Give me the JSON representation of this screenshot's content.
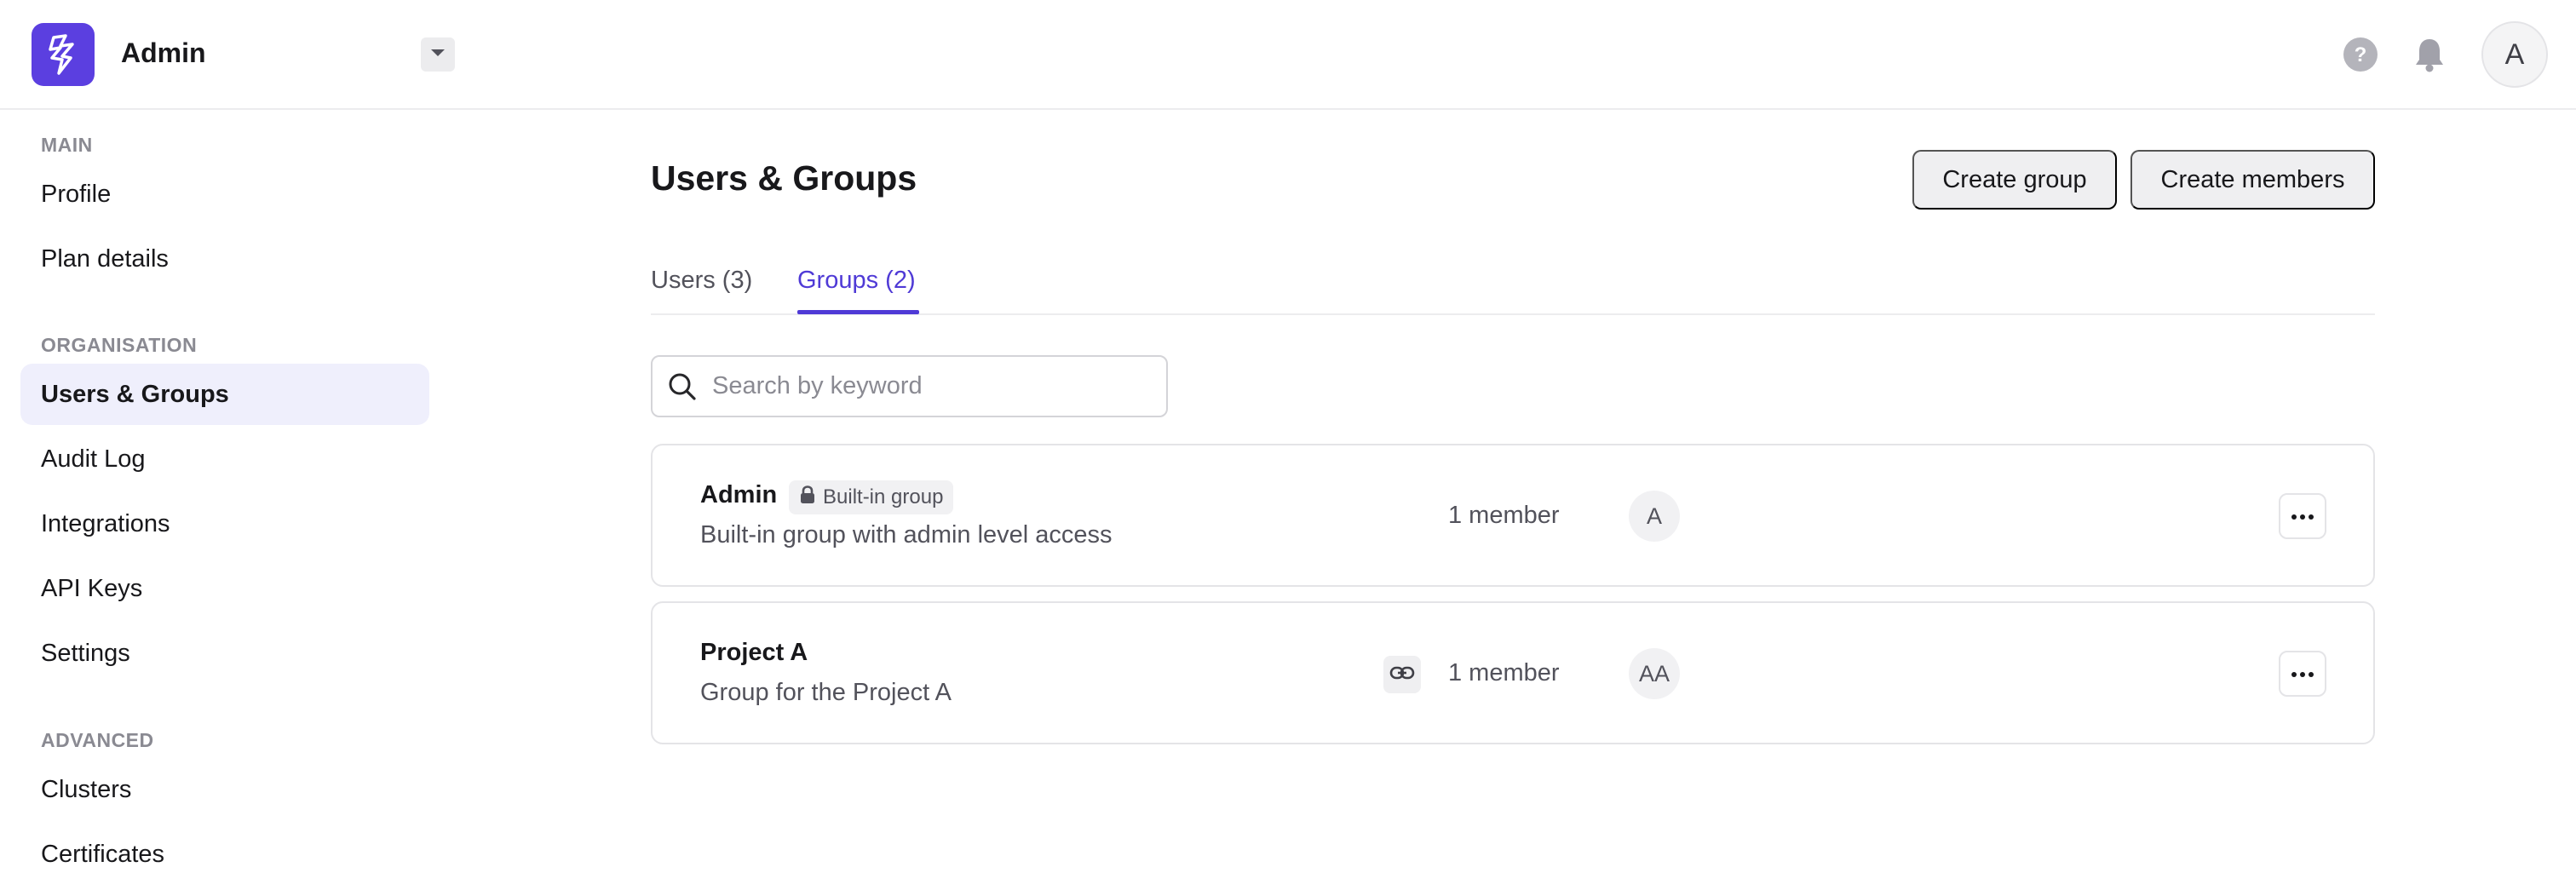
{
  "header": {
    "app_title": "Admin",
    "avatar_initial": "A",
    "icons": [
      "logo-icon",
      "chevron-down-icon",
      "help-icon",
      "bell-icon"
    ]
  },
  "sidebar": {
    "sections": [
      {
        "title": "MAIN",
        "items": [
          {
            "label": "Profile"
          },
          {
            "label": "Plan details"
          }
        ]
      },
      {
        "title": "ORGANISATION",
        "items": [
          {
            "label": "Users & Groups",
            "active": true
          },
          {
            "label": "Audit Log"
          },
          {
            "label": "Integrations"
          },
          {
            "label": "API Keys"
          },
          {
            "label": "Settings"
          }
        ]
      },
      {
        "title": "ADVANCED",
        "items": [
          {
            "label": "Clusters"
          },
          {
            "label": "Certificates"
          }
        ]
      }
    ]
  },
  "main": {
    "title": "Users & Groups",
    "buttons": {
      "create_group": "Create group",
      "create_members": "Create members"
    },
    "tabs": [
      {
        "label": "Users (3)"
      },
      {
        "label": "Groups (2)",
        "active": true
      }
    ],
    "search": {
      "placeholder": "Search by keyword",
      "value": ""
    },
    "groups": [
      {
        "name": "Admin",
        "badge": "Built-in group",
        "description": "Built-in group with admin level access",
        "members": "1 member",
        "avatar": "A"
      },
      {
        "name": "Project A",
        "description": "Group for the Project A",
        "members": "1 member",
        "avatar": "AA"
      }
    ]
  },
  "colors": {
    "accent": "#4f3ad6",
    "logo_bg": "#5b3fe0",
    "active_nav_bg": "#efeffc"
  }
}
